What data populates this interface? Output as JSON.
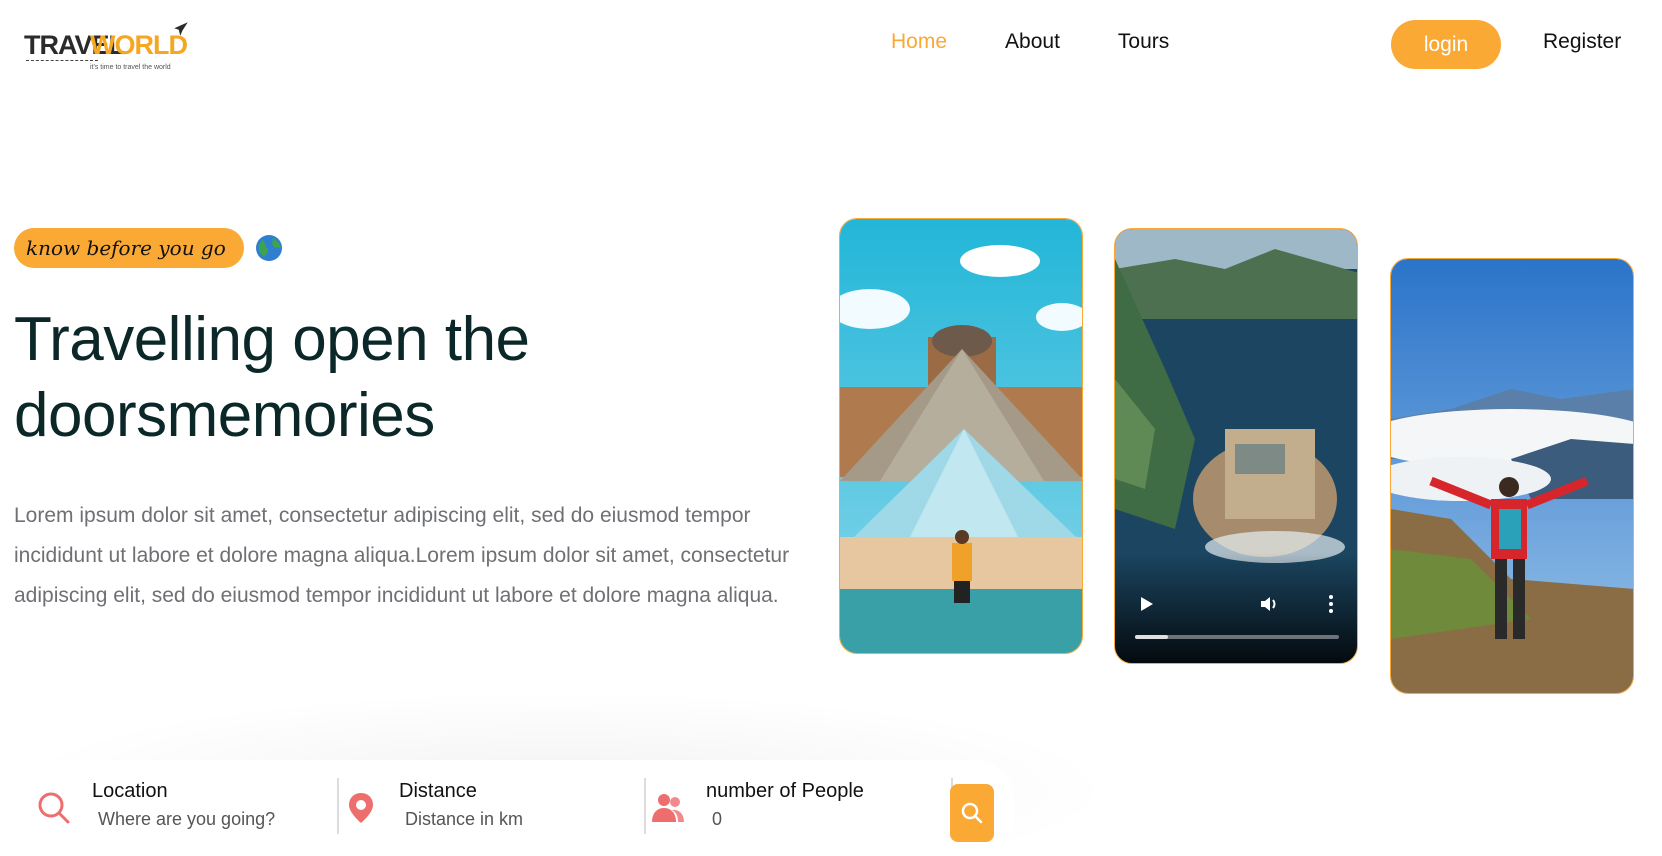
{
  "header": {
    "logo_word_1": "TRAVEL",
    "logo_word_2": "WORLD",
    "logo_tagline": "it's time to travel the world",
    "nav": [
      {
        "label": "Home",
        "active": true
      },
      {
        "label": "About",
        "active": false
      },
      {
        "label": "Tours",
        "active": false
      }
    ],
    "login_label": "login",
    "register_label": "Register"
  },
  "hero": {
    "subtitle": "know before you go",
    "subtitle_icon": "globe-icon",
    "title_line_1": "Travelling open the",
    "title_line_2": "doorsmemories",
    "description": "Lorem ipsum dolor sit amet, consectetur adipiscing elit, sed do eiusmod tempor incididunt ut labore et dolore magna aliqua.Lorem ipsum dolor sit amet, consectetur adipiscing elit, sed do eiusmod tempor incididunt ut labore et dolore magna aliqua."
  },
  "media": {
    "video_progress": 0.16
  },
  "search": {
    "location": {
      "label": "Location",
      "placeholder": "Where are you going?",
      "icon": "search-icon"
    },
    "distance": {
      "label": "Distance",
      "placeholder": "Distance in km",
      "icon": "map-pin-icon"
    },
    "people": {
      "label": "number of People",
      "value": "0",
      "icon": "people-icon"
    },
    "button_icon": "search-icon"
  },
  "colors": {
    "accent": "#faa935",
    "heading": "#0b2727",
    "text": "#6e7074",
    "icon": "#ee6e6e"
  }
}
